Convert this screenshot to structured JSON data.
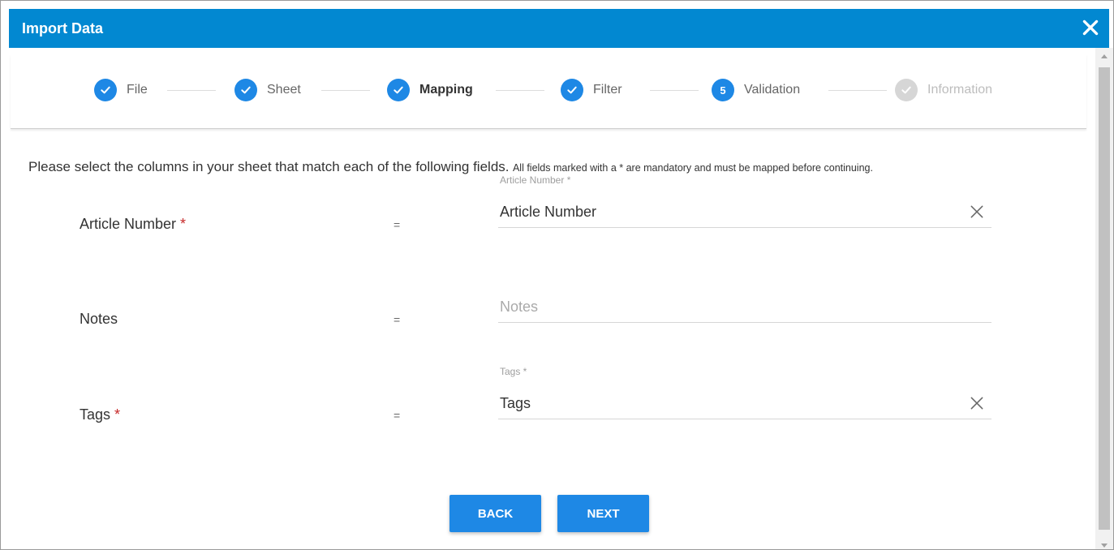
{
  "dialog": {
    "title": "Import Data"
  },
  "stepper": {
    "steps": [
      {
        "label": "File",
        "state": "complete",
        "badge": ""
      },
      {
        "label": "Sheet",
        "state": "complete",
        "badge": ""
      },
      {
        "label": "Mapping",
        "state": "current-complete",
        "badge": ""
      },
      {
        "label": "Filter",
        "state": "complete",
        "badge": ""
      },
      {
        "label": "Validation",
        "state": "numbered",
        "badge": "5"
      },
      {
        "label": "Information",
        "state": "disabled",
        "badge": ""
      }
    ]
  },
  "instructions": {
    "main": "Please select the columns in your sheet that match each of the following fields.",
    "note": "All fields marked with a * are mandatory and must be mapped before continuing."
  },
  "fields": [
    {
      "label": "Article Number",
      "required_mark": "*",
      "equals": "=",
      "float_label": "Article Number *",
      "value": "Article Number",
      "placeholder": ""
    },
    {
      "label": "Notes",
      "required_mark": "",
      "equals": "=",
      "float_label": "",
      "value": "",
      "placeholder": "Notes"
    },
    {
      "label": "Tags",
      "required_mark": "*",
      "equals": "=",
      "float_label": "Tags *",
      "value": "Tags",
      "placeholder": ""
    }
  ],
  "buttons": {
    "back": "BACK",
    "next": "NEXT"
  },
  "colors": {
    "titlebar": "#0288d1",
    "accent": "#1e88e5",
    "required": "#c62828",
    "disabled": "#d6d6d6"
  },
  "icons": {
    "close": "close-icon",
    "check": "check-icon",
    "clear": "clear-icon"
  }
}
